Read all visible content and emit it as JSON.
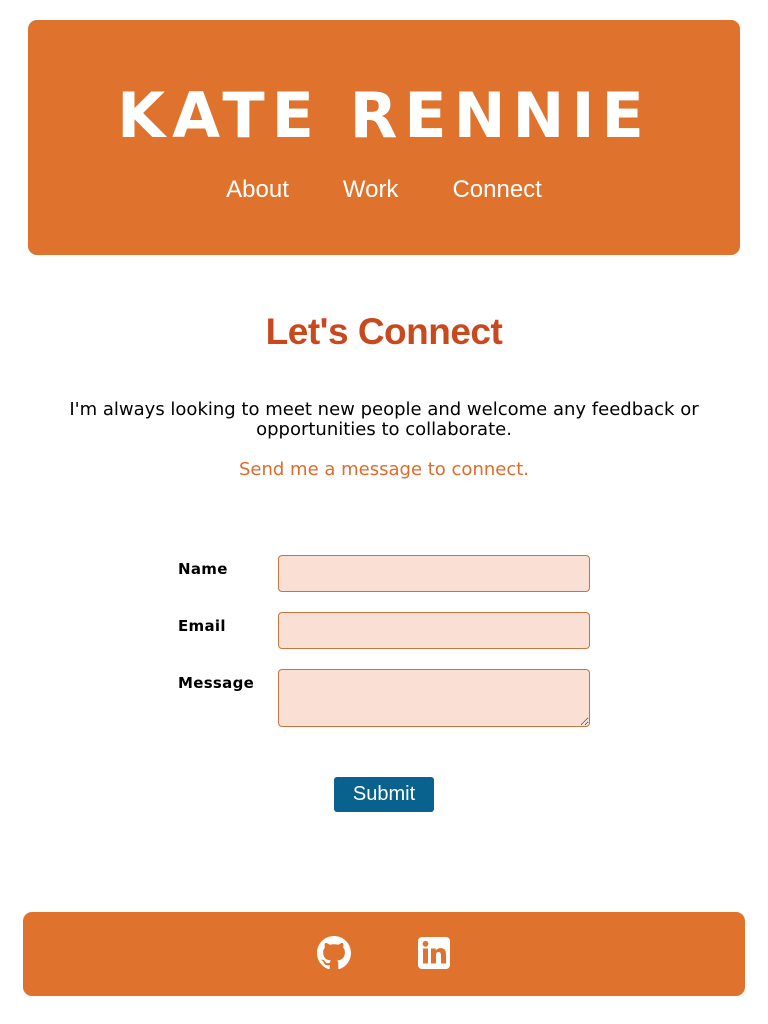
{
  "header": {
    "site_title": "KATE RENNIE",
    "nav": [
      {
        "label": "About"
      },
      {
        "label": "Work"
      },
      {
        "label": "Connect"
      }
    ]
  },
  "main": {
    "heading": "Let's Connect",
    "intro": "I'm always looking to meet new people and welcome any feedback or opportunities to collaborate.",
    "cta": "Send me a message to connect.",
    "form": {
      "name_label": "Name",
      "name_value": "",
      "email_label": "Email",
      "email_value": "",
      "message_label": "Message",
      "message_value": "",
      "submit_label": "Submit"
    }
  },
  "footer": {
    "social": [
      {
        "icon": "github-icon"
      },
      {
        "icon": "linkedin-icon"
      }
    ]
  },
  "colors": {
    "brand_orange": "#df732d",
    "heading_red": "#c9491e",
    "cta_orange": "#df6a2a",
    "input_fill": "#fae0d4",
    "input_border": "#c8743f",
    "submit_blue": "#09628e",
    "background": "#ffffff"
  }
}
